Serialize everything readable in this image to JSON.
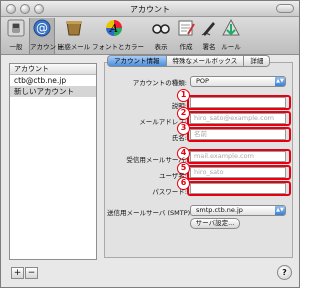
{
  "window": {
    "title": "アカウント"
  },
  "toolbar": {
    "items": [
      {
        "label": "一般",
        "icon": "switch-icon"
      },
      {
        "label": "アカウント",
        "icon": "at-sign-icon"
      },
      {
        "label": "迷惑メール",
        "icon": "junk-mail-icon"
      },
      {
        "label": "フォントとカラー",
        "icon": "font-color-icon"
      },
      {
        "label": "表示",
        "icon": "glasses-icon"
      },
      {
        "label": "作成",
        "icon": "compose-icon"
      },
      {
        "label": "署名",
        "icon": "pen-icon"
      },
      {
        "label": "ルール",
        "icon": "rules-icon"
      }
    ]
  },
  "sidebar": {
    "header": "アカウント",
    "items": [
      {
        "label": "ctb@ctb.ne.jp"
      },
      {
        "label": "新しいアカウント"
      }
    ],
    "add_label": "+",
    "remove_label": "−"
  },
  "tabs": [
    {
      "label": "アカウント情報"
    },
    {
      "label": "特殊なメールボックス"
    },
    {
      "label": "詳細"
    }
  ],
  "form": {
    "account_type": {
      "label": "アカウントの種類:",
      "value": "POP"
    },
    "description": {
      "label": "説明:",
      "value": ""
    },
    "email": {
      "label": "メールアドレス:",
      "placeholder": "hiro_sato@example.com"
    },
    "full_name": {
      "label": "氏名:",
      "placeholder": "名前"
    },
    "incoming_server": {
      "label": "受信用メールサーバ:",
      "placeholder": "mail.example.com"
    },
    "user_name": {
      "label": "ユーザ名:",
      "placeholder": "hiro_sato"
    },
    "password": {
      "label": "パスワード:",
      "value": ""
    },
    "smtp": {
      "label": "送信用メールサーバ (SMTP):",
      "value": "smtp.ctb.ne.jp"
    },
    "server_settings_button": "サーバ設定..."
  },
  "badges": [
    "1",
    "2",
    "3",
    "4",
    "5",
    "6"
  ],
  "help_label": "?",
  "colors": {
    "highlight": "#e8000e",
    "tab_active": "#4c8fdd"
  }
}
